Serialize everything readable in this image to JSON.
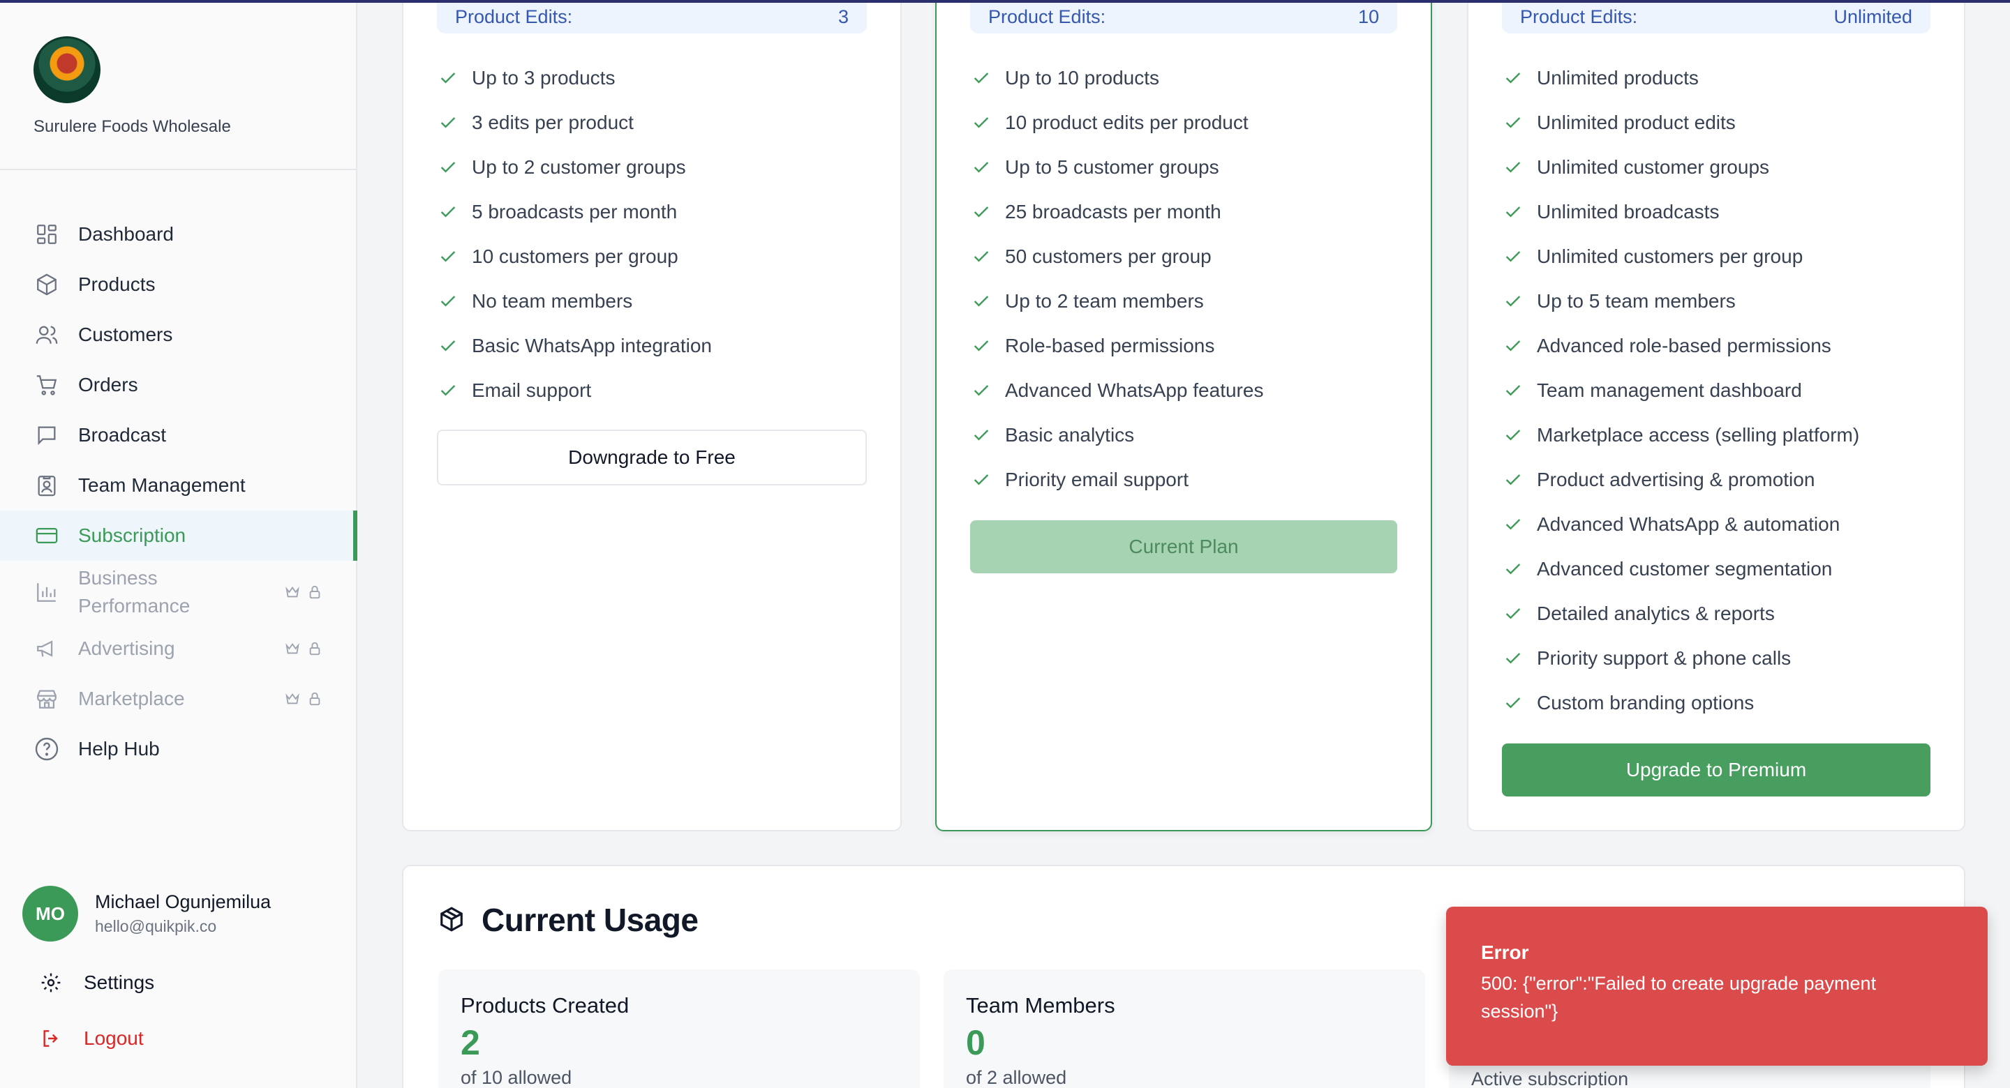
{
  "sidebar": {
    "brand_name": "Surulere Foods Wholesale",
    "nav": [
      {
        "label": "Dashboard",
        "icon": "dashboard-icon"
      },
      {
        "label": "Products",
        "icon": "box-icon"
      },
      {
        "label": "Customers",
        "icon": "users-icon"
      },
      {
        "label": "Orders",
        "icon": "cart-icon"
      },
      {
        "label": "Broadcast",
        "icon": "message-icon"
      },
      {
        "label": "Team Management",
        "icon": "id-badge-icon"
      },
      {
        "label": "Subscription",
        "icon": "credit-card-icon",
        "active": true
      },
      {
        "label": "Business Performance",
        "icon": "bar-chart-icon",
        "locked": true
      },
      {
        "label": "Advertising",
        "icon": "megaphone-icon",
        "locked": true
      },
      {
        "label": "Marketplace",
        "icon": "store-icon",
        "locked": true
      },
      {
        "label": "Help Hub",
        "icon": "help-circle-icon"
      }
    ],
    "user": {
      "initials": "MO",
      "name": "Michael Ogunjemilua",
      "email": "hello@quikpik.co"
    },
    "settings_label": "Settings",
    "logout_label": "Logout"
  },
  "plans": [
    {
      "edits_label": "Product Edits:",
      "edits_value": "3",
      "features": [
        "Up to 3 products",
        "3 edits per product",
        "Up to 2 customer groups",
        "5 broadcasts per month",
        "10 customers per group",
        "No team members",
        "Basic WhatsApp integration",
        "Email support"
      ],
      "button_label": "Downgrade to Free"
    },
    {
      "edits_label": "Product Edits:",
      "edits_value": "10",
      "features": [
        "Up to 10 products",
        "10 product edits per product",
        "Up to 5 customer groups",
        "25 broadcasts per month",
        "50 customers per group",
        "Up to 2 team members",
        "Role-based permissions",
        "Advanced WhatsApp features",
        "Basic analytics",
        "Priority email support"
      ],
      "button_label": "Current Plan"
    },
    {
      "edits_label": "Product Edits:",
      "edits_value": "Unlimited",
      "features": [
        "Unlimited products",
        "Unlimited product edits",
        "Unlimited customer groups",
        "Unlimited broadcasts",
        "Unlimited customers per group",
        "Up to 5 team members",
        "Advanced role-based permissions",
        "Team management dashboard",
        "Marketplace access (selling platform)",
        "Product advertising & promotion",
        "Advanced WhatsApp & automation",
        "Advanced customer segmentation",
        "Detailed analytics & reports",
        "Priority support & phone calls",
        "Custom branding options"
      ],
      "button_label": "Upgrade to Premium"
    }
  ],
  "usage": {
    "title": "Current Usage",
    "stats": [
      {
        "label": "Products Created",
        "value": "2",
        "sub": "of 10 allowed"
      },
      {
        "label": "Team Members",
        "value": "0",
        "sub": "of 2 allowed"
      },
      {
        "sub": "Active subscription"
      }
    ]
  },
  "toast": {
    "title": "Error",
    "message": "500: {\"error\":\"Failed to create upgrade payment session\"}"
  },
  "colors": {
    "accent": "#3b9a57",
    "error": "#dc4b4b",
    "edits_text": "#3457b0"
  }
}
